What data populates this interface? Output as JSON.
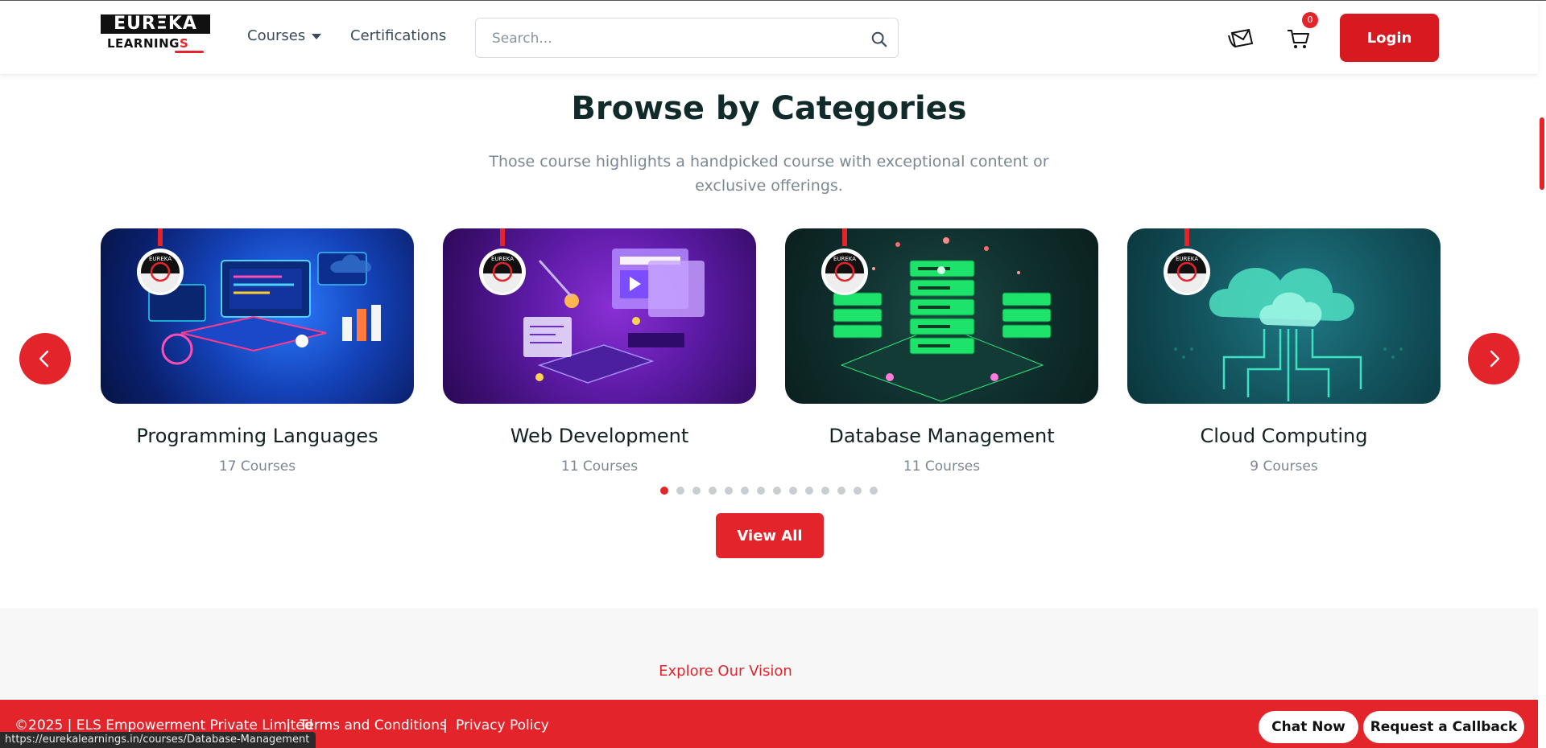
{
  "header": {
    "logo_line1": "EURΞKA",
    "logo_line2": "LEARNING",
    "logo_line2_suffix": "S",
    "nav": {
      "courses": "Courses",
      "certifications": "Certifications"
    },
    "search": {
      "placeholder": "Search...",
      "value": ""
    },
    "cart_count": "0",
    "login_label": "Login"
  },
  "section": {
    "title": "Browse by Categories",
    "subtitle": "Those course highlights a handpicked course with exceptional content or exclusive offerings.",
    "categories": [
      {
        "name": "Programming Languages",
        "count": "17 Courses",
        "theme": "blue"
      },
      {
        "name": "Web Development",
        "count": "11 Courses",
        "theme": "purple"
      },
      {
        "name": "Database Management",
        "count": "11 Courses",
        "theme": "green"
      },
      {
        "name": "Cloud Computing",
        "count": "9 Courses",
        "theme": "teal"
      }
    ],
    "carousel_dots": 14,
    "active_dot": 0,
    "view_all_label": "View All"
  },
  "vision": {
    "label": "Explore Our Vision"
  },
  "footer": {
    "copyright": "©2025 | ELS Empowerment Private Limited",
    "separator": "|",
    "terms": "Terms and Conditions",
    "privacy": "Privacy Policy",
    "chat_now": "Chat Now",
    "request_callback": "Request a Callback"
  },
  "status_bar": {
    "url": "https://eurekalearnings.in/courses/Database-Management"
  },
  "colors": {
    "brand_red": "#e3242b",
    "login_red": "#d71920",
    "title": "#112b2a"
  },
  "icons": [
    "caret-down-icon",
    "search-icon",
    "mail-icon",
    "cart-icon",
    "chevron-left-icon",
    "chevron-right-icon"
  ]
}
